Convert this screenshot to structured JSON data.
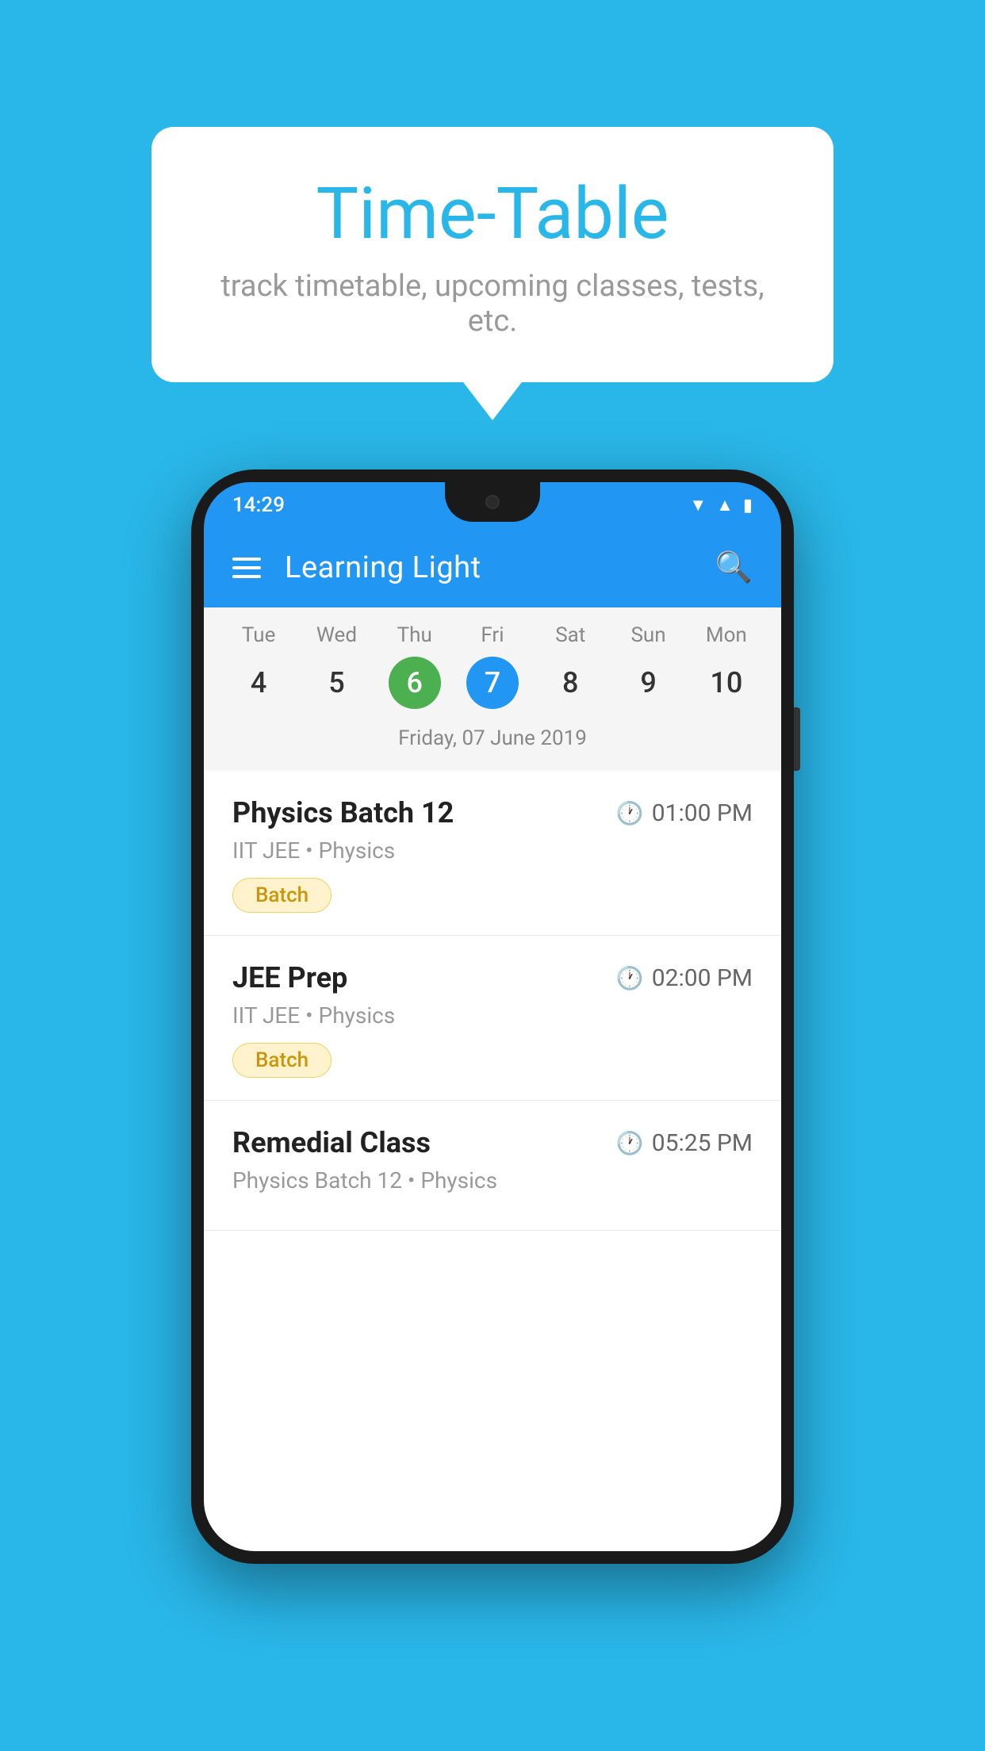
{
  "background_color": "#29b6e8",
  "bubble": {
    "title": "Time-Table",
    "subtitle": "track timetable, upcoming classes, tests, etc."
  },
  "phone": {
    "status_time": "14:29",
    "app_bar": {
      "title": "Learning Light"
    },
    "calendar": {
      "days": [
        {
          "name": "Tue",
          "num": "4",
          "state": "normal"
        },
        {
          "name": "Wed",
          "num": "5",
          "state": "normal"
        },
        {
          "name": "Thu",
          "num": "6",
          "state": "today"
        },
        {
          "name": "Fri",
          "num": "7",
          "state": "selected"
        },
        {
          "name": "Sat",
          "num": "8",
          "state": "normal"
        },
        {
          "name": "Sun",
          "num": "9",
          "state": "normal"
        },
        {
          "name": "Mon",
          "num": "10",
          "state": "normal"
        }
      ],
      "selected_date_label": "Friday, 07 June 2019"
    },
    "schedule": [
      {
        "title": "Physics Batch 12",
        "time": "01:00 PM",
        "subtitle": "IIT JEE • Physics",
        "tag": "Batch"
      },
      {
        "title": "JEE Prep",
        "time": "02:00 PM",
        "subtitle": "IIT JEE • Physics",
        "tag": "Batch"
      },
      {
        "title": "Remedial Class",
        "time": "05:25 PM",
        "subtitle": "Physics Batch 12 • Physics",
        "tag": null
      }
    ]
  }
}
